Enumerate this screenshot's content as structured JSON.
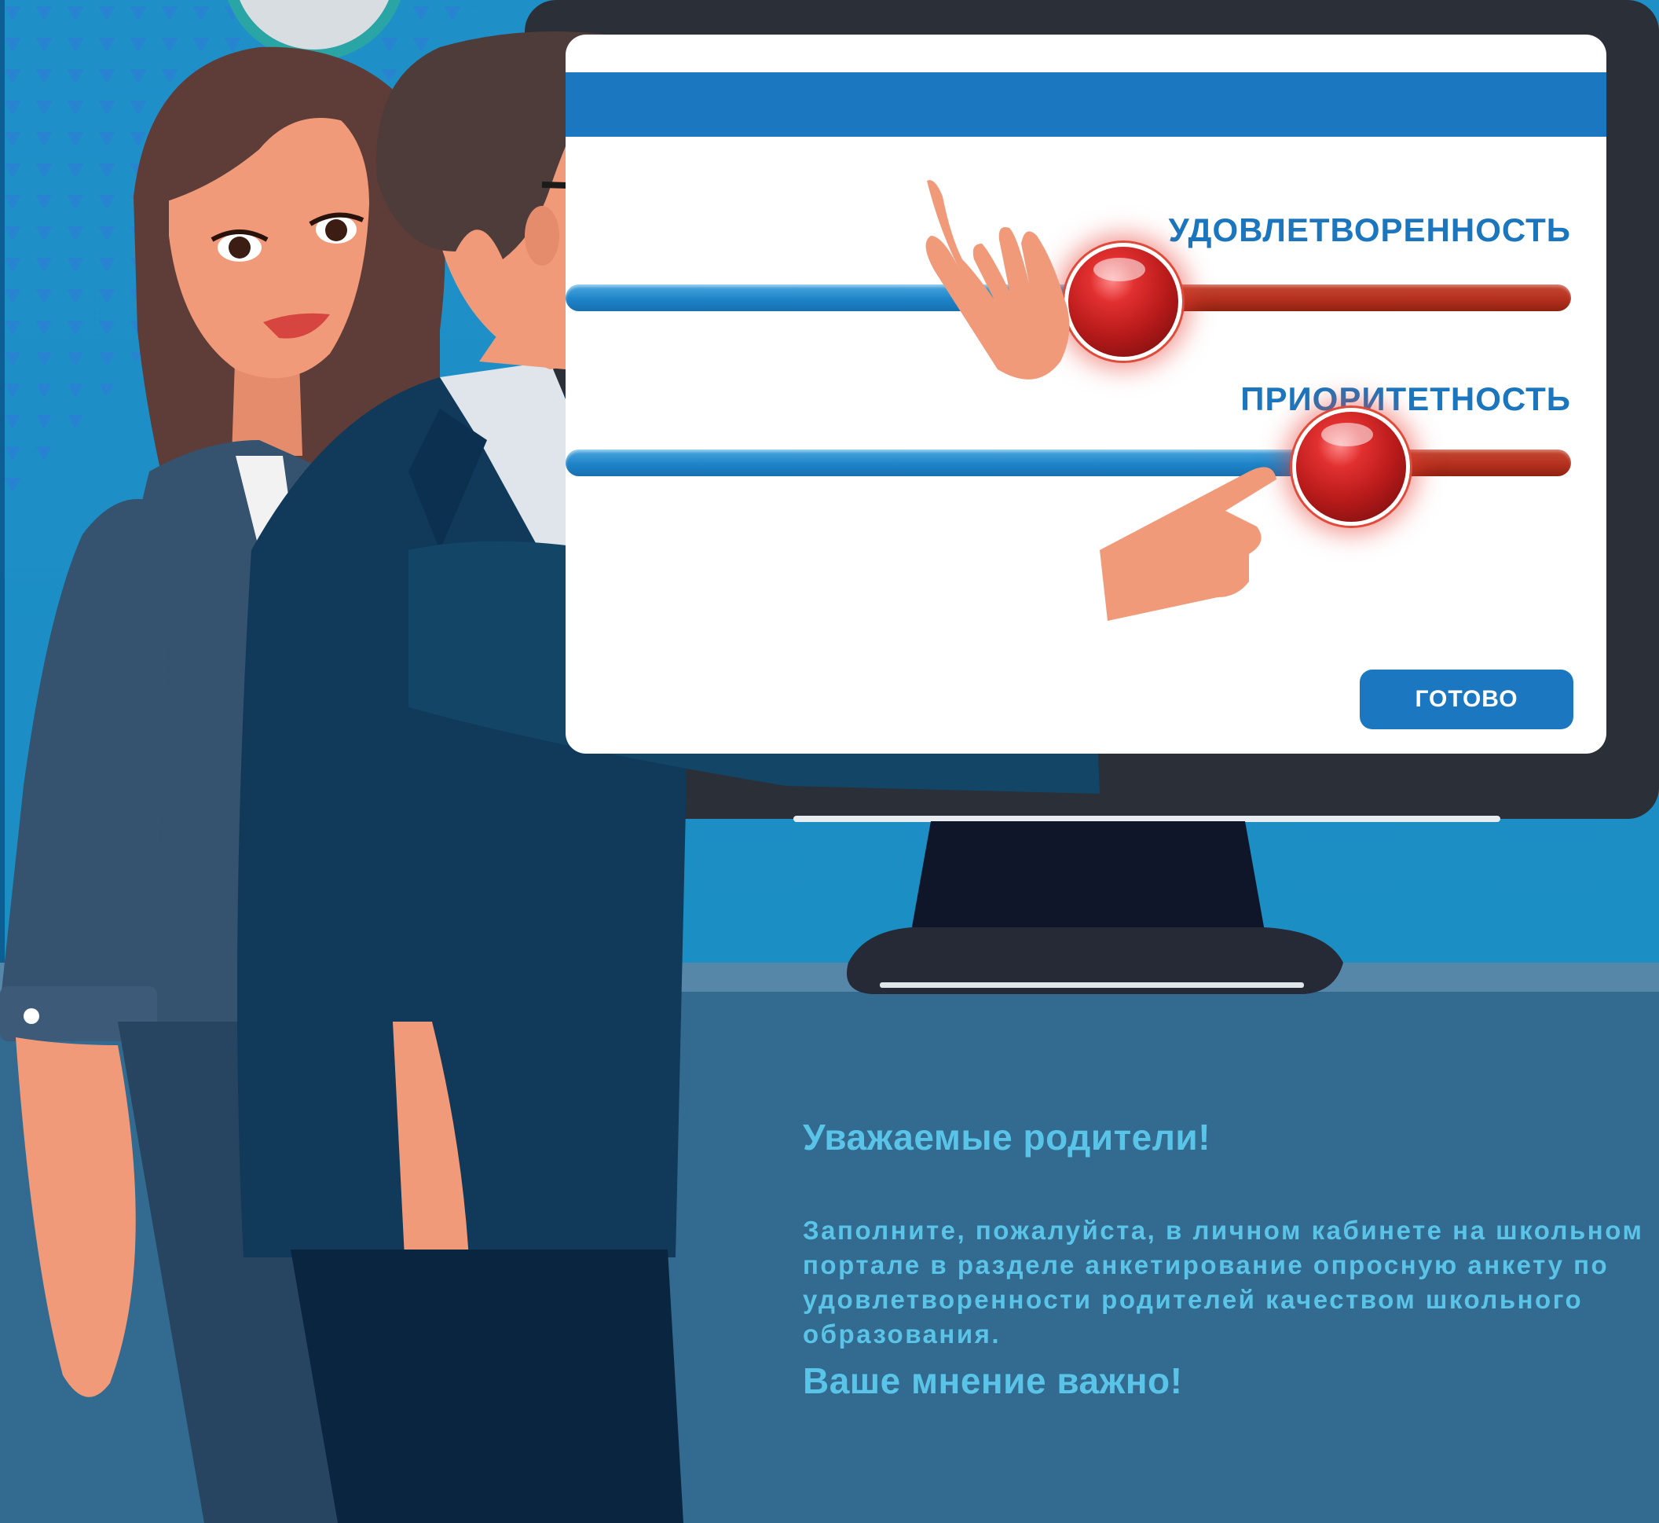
{
  "screen": {
    "slider1": {
      "label": "УДОВЛЕТВОРЕННОСТЬ"
    },
    "slider2": {
      "label": "ПРИОРИТЕТНОСТЬ"
    },
    "done_label": "ГОТОВО"
  },
  "message": {
    "greeting": "Уважаемые родители!",
    "body": "Заполните, пожалуйста, в личном кабинете на школьном портале в разделе анкетирование  опросную анкету по удовлетворенности родителей качеством школьного образования.",
    "closing": "Ваше мнение важно!"
  },
  "colors": {
    "background": "#1b88bf",
    "accent_blue": "#1b78c0",
    "slider_red": "#b5301e",
    "text_cyan": "#5ac4e8"
  }
}
